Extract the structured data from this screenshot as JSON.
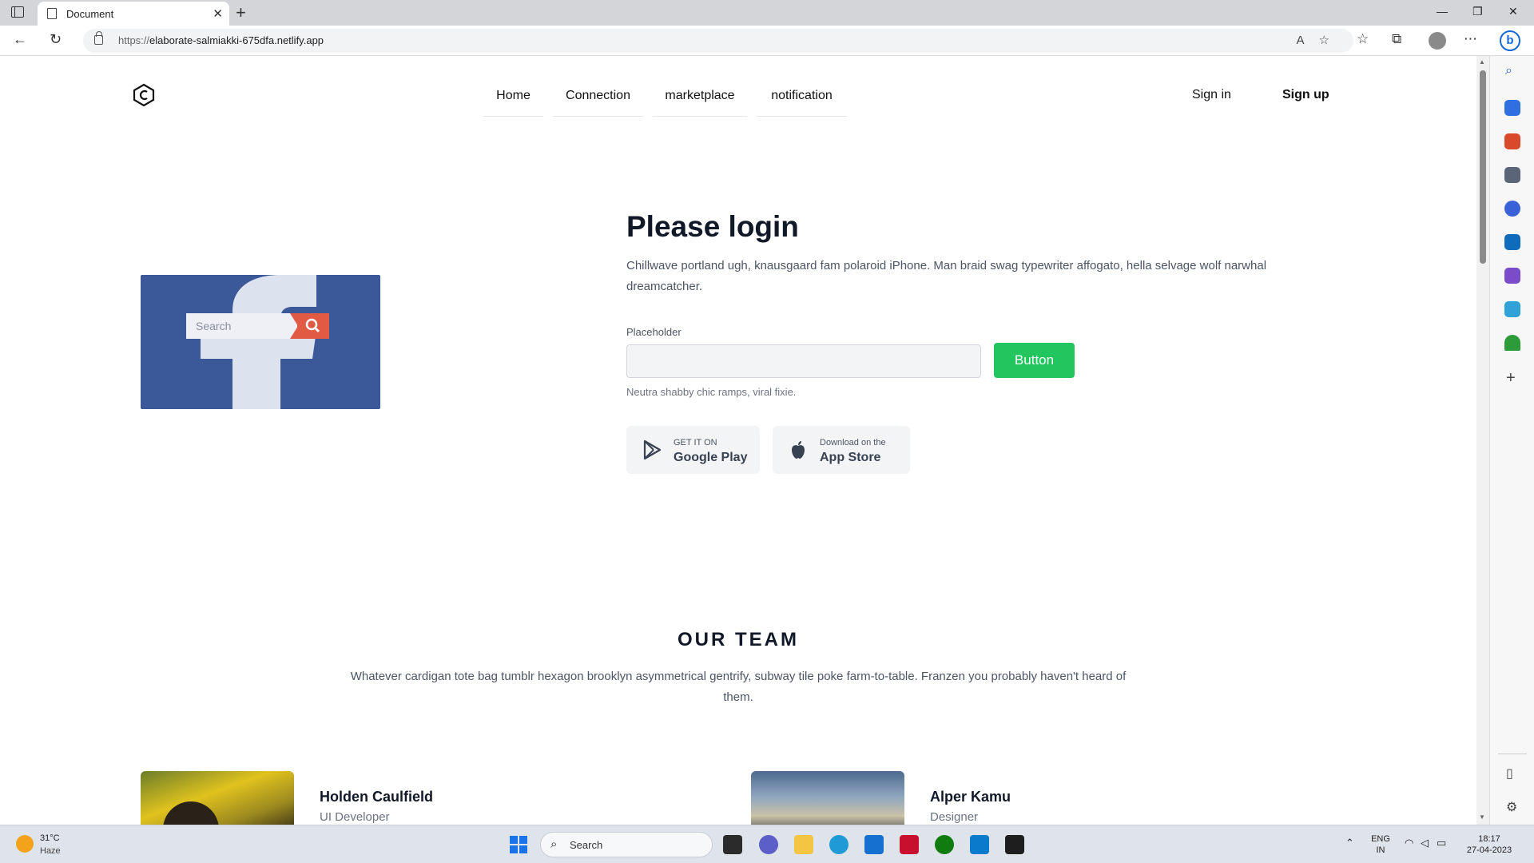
{
  "browser": {
    "tab_title": "Document",
    "url_scheme": "https://",
    "url_host": "elaborate-salmiakki-675dfa.netlify.app"
  },
  "nav": {
    "links": [
      "Home",
      "Connection",
      "marketplace",
      "notification"
    ],
    "signin": "Sign in",
    "signup": "Sign up"
  },
  "hero": {
    "image_search_placeholder": "Search",
    "title": "Please login",
    "description": "Chillwave portland ugh, knausgaard fam polaroid iPhone. Man braid swag typewriter affogato, hella selvage wolf narwhal dreamcatcher.",
    "field_label": "Placeholder",
    "field_value": "",
    "button_label": "Button",
    "helper_text": "Neutra shabby chic ramps, viral fixie.",
    "google_play": {
      "small": "GET IT ON",
      "big": "Google Play"
    },
    "app_store": {
      "small": "Download on the",
      "big": "App Store"
    }
  },
  "team": {
    "title": "OUR TEAM",
    "description": "Whatever cardigan tote bag tumblr hexagon brooklyn asymmetrical gentrify, subway tile poke farm-to-table. Franzen you probably haven't heard of them.",
    "members": [
      {
        "name": "Holden Caulfield",
        "role": "UI Developer"
      },
      {
        "name": "Alper Kamu",
        "role": "Designer"
      }
    ]
  },
  "taskbar": {
    "weather_temp": "31°C",
    "weather_cond": "Haze",
    "search_label": "Search",
    "lang_top": "ENG",
    "lang_bottom": "IN",
    "time": "18:17",
    "date": "27-04-2023"
  },
  "colors": {
    "accent_green": "#22c55e",
    "facebook_blue": "#3b5998",
    "search_red": "#e05a44"
  }
}
